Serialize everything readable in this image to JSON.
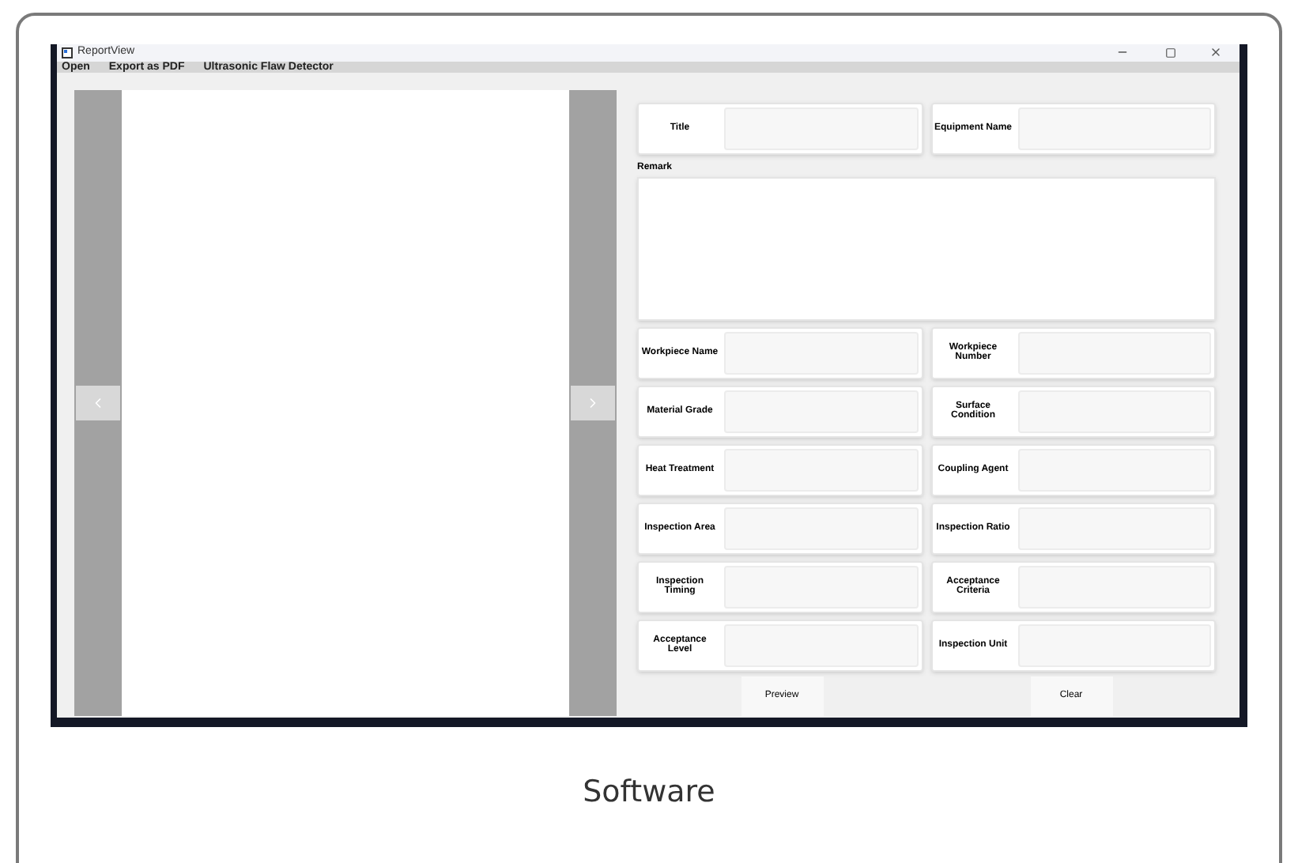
{
  "window": {
    "title": "ReportView"
  },
  "menu": [
    "Open",
    "Export as PDF",
    "Ultrasonic Flaw Detector"
  ],
  "header_fields": [
    {
      "label": "Title"
    },
    {
      "label": "Equipment Name"
    }
  ],
  "remark": {
    "label": "Remark"
  },
  "fields": [
    {
      "label": "Workpiece Name"
    },
    {
      "label": "Workpiece Number"
    },
    {
      "label": "Material Grade"
    },
    {
      "label": "Surface Condition"
    },
    {
      "label": "Heat Treatment"
    },
    {
      "label": "Coupling Agent"
    },
    {
      "label": "Inspection Area"
    },
    {
      "label": "Inspection Ratio"
    },
    {
      "label": "Inspection Timing"
    },
    {
      "label": "Acceptance Criteria"
    },
    {
      "label": "Acceptance Level"
    },
    {
      "label": "Inspection Unit"
    }
  ],
  "buttons": [
    "Preview",
    "Clear"
  ],
  "caption": "Software"
}
